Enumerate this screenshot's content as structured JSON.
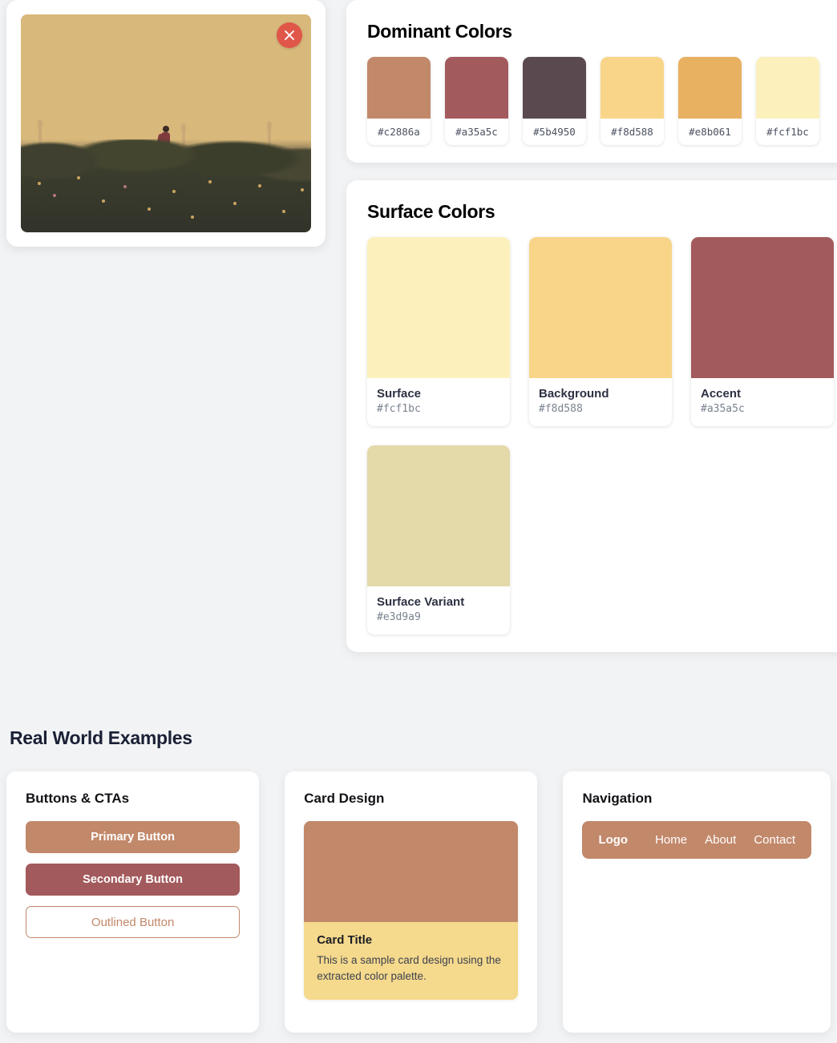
{
  "image_preview": {
    "close_label": "×",
    "alt": "sunset-cityscape-runner-photo"
  },
  "dominant": {
    "title": "Dominant Colors",
    "swatches": [
      {
        "hex": "#c2886a"
      },
      {
        "hex": "#a35a5c"
      },
      {
        "hex": "#5b4950"
      },
      {
        "hex": "#f8d588"
      },
      {
        "hex": "#e8b061"
      },
      {
        "hex": "#fcf1bc"
      }
    ]
  },
  "surface": {
    "title": "Surface Colors",
    "cards": [
      {
        "name": "Surface",
        "hex": "#fcf1bc"
      },
      {
        "name": "Background",
        "hex": "#f8d588"
      },
      {
        "name": "Accent",
        "hex": "#a35a5c"
      },
      {
        "name": "Surface Variant",
        "hex": "#e3d9a9"
      }
    ]
  },
  "examples": {
    "title": "Real World Examples",
    "buttons_card": {
      "title": "Buttons & CTAs",
      "primary": "Primary Button",
      "secondary": "Secondary Button",
      "outlined": "Outlined Button"
    },
    "card_design": {
      "title": "Card Design",
      "card_title": "Card Title",
      "card_text": "This is a sample card design using the extracted color palette."
    },
    "navigation": {
      "title": "Navigation",
      "logo": "Logo",
      "links": [
        "Home",
        "About",
        "Contact"
      ]
    }
  },
  "colors": {
    "page_bg": "#f1f3f5",
    "close_btn": "#e0574a",
    "primary": "#c2886a",
    "secondary": "#a35a5c",
    "card_img": "#c2886a",
    "card_body": "#f5d98c",
    "nav_bg": "#c2886a"
  }
}
